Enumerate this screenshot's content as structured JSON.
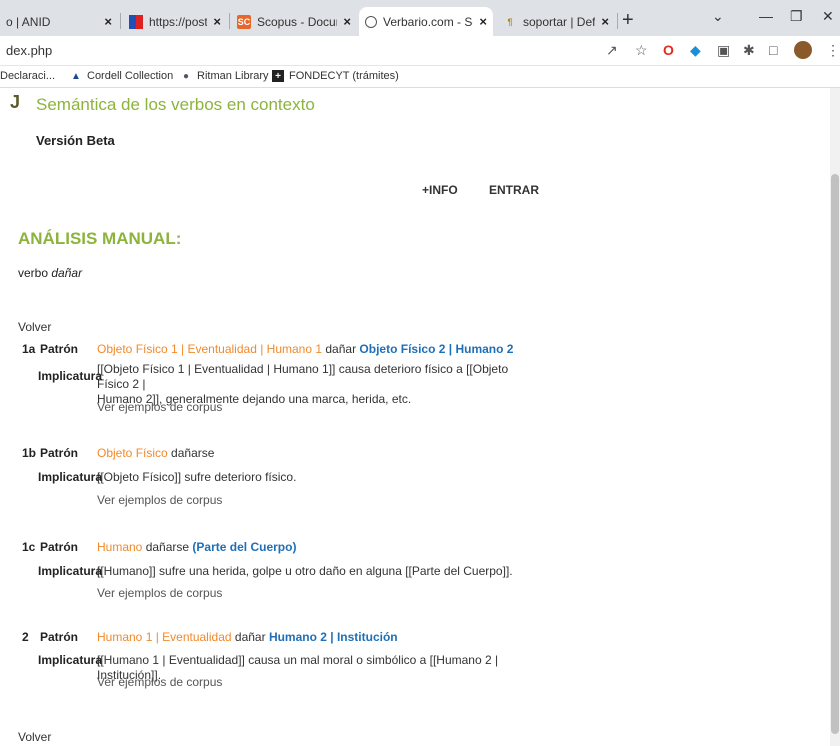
{
  "browser": {
    "tabs": [
      {
        "title": "o | ANID",
        "favicon": "none",
        "active": false
      },
      {
        "title": "https://post.conicyt",
        "favicon": "flag-icon",
        "active": false
      },
      {
        "title": "Scopus - Documen",
        "favicon": "scopus-icon",
        "favicon_text": "SC",
        "active": false
      },
      {
        "title": "Verbario.com - Sem",
        "favicon": "globe-icon",
        "active": true
      },
      {
        "title": "soportar | Definición",
        "favicon": "rae-icon",
        "active": false
      }
    ],
    "new_tab_symbol": "+",
    "close_symbol": "×",
    "url": "dex.php",
    "bookmarks": [
      {
        "label": "Declaraci...",
        "icon": "none"
      },
      {
        "label": "Cordell Collection",
        "icon": "ship-icon"
      },
      {
        "label": "Ritman Library",
        "icon": "circle-icon"
      },
      {
        "label": "FONDECYT (trámites)",
        "icon": "plus-square-icon"
      }
    ]
  },
  "page": {
    "brand_glyph": "J",
    "site_title": "Semántica de los verbos en contexto",
    "version": "Versión Beta",
    "nav": {
      "info": "+INFO",
      "enter": "ENTRAR"
    },
    "section_heading": "ANÁLISIS MANUAL:",
    "verb_prefix": "verbo",
    "verb": "dañar",
    "back_label": "Volver",
    "corpus_link_label": "Ver ejemplos de corpus",
    "patron_label": "Patrón",
    "implicatura_label": "Implicatura",
    "entries": [
      {
        "id": "1a",
        "pattern_subject": "Objeto Físico 1 | Eventualidad | Humano 1",
        "pattern_verb": "dañar",
        "pattern_object": "Objeto Físico 2 | Humano 2",
        "impl_line1": "[[Objeto Físico 1 | Eventualidad | Humano 1]] causa deterioro físico a [[Objeto Físico 2 |",
        "impl_line2": "Humano 2]], generalmente dejando una marca, herida, etc."
      },
      {
        "id": "1b",
        "pattern_subject": "Objeto Físico",
        "pattern_verb": "dañarse",
        "pattern_object": "",
        "impl_line1": "[[Objeto Físico]] sufre deterioro físico.",
        "impl_line2": ""
      },
      {
        "id": "1c",
        "pattern_subject": "Humano",
        "pattern_verb": "dañarse",
        "pattern_object": "(Parte del Cuerpo)",
        "impl_line1": "[[Humano]] sufre una herida, golpe u otro daño en alguna [[Parte del Cuerpo]].",
        "impl_line2": ""
      },
      {
        "id": "2",
        "pattern_subject": "Humano 1 | Eventualidad",
        "pattern_verb": "dañar",
        "pattern_object": "Humano 2 | Institución",
        "impl_line1": "[[Humano 1 | Eventualidad]] causa un mal moral o simbólico a [[Humano 2 | Institución]].",
        "impl_line2": ""
      }
    ]
  }
}
